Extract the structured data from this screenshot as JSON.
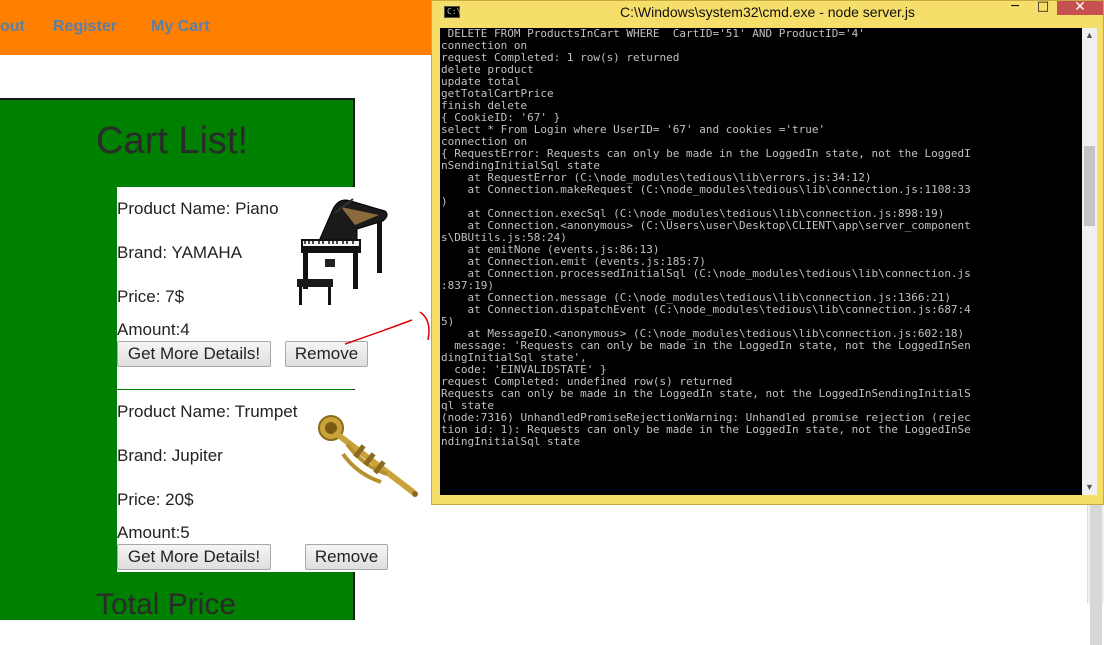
{
  "nav": {
    "items": [
      {
        "label": "out"
      },
      {
        "label": "Register"
      },
      {
        "label": "My Cart"
      }
    ]
  },
  "cart": {
    "title": "Cart List!",
    "total_label": "Total Price",
    "products": [
      {
        "name": "Product Name: Piano",
        "brand": "Brand: YAMAHA",
        "price": "Price: 7$",
        "amount": "Amount:4",
        "details_label": "Get More Details!",
        "remove_label": "Remove"
      },
      {
        "name": "Product Name: Trumpet",
        "brand": "Brand: Jupiter",
        "price": "Price: 20$",
        "amount": "Amount:5",
        "details_label": "Get More Details!",
        "remove_label": "Remove"
      }
    ]
  },
  "cmd": {
    "title": "C:\\Windows\\system32\\cmd.exe - node  server.js",
    "controls": {
      "minimize": "─",
      "maximize": "□",
      "close": "✕"
    },
    "icon_text": "C:\\",
    "output": " DELETE FROM ProductsInCart WHERE  CartID='51' AND ProductID='4'\nconnection on\nrequest Completed: 1 row(s) returned\ndelete product\nupdate total\ngetTotalCartPrice\nfinish delete\n{ CookieID: '67' }\nselect * From Login where UserID= '67' and cookies ='true'\nconnection on\n{ RequestError: Requests can only be made in the LoggedIn state, not the LoggedI\nnSendingInitialSql state\n    at RequestError (C:\\node_modules\\tedious\\lib\\errors.js:34:12)\n    at Connection.makeRequest (C:\\node_modules\\tedious\\lib\\connection.js:1108:33\n)\n    at Connection.execSql (C:\\node_modules\\tedious\\lib\\connection.js:898:19)\n    at Connection.<anonymous> (C:\\Users\\user\\Desktop\\CLIENT\\app\\server_component\ns\\DBUtils.js:58:24)\n    at emitNone (events.js:86:13)\n    at Connection.emit (events.js:185:7)\n    at Connection.processedInitialSql (C:\\node_modules\\tedious\\lib\\connection.js\n:837:19)\n    at Connection.message (C:\\node_modules\\tedious\\lib\\connection.js:1366:21)\n    at Connection.dispatchEvent (C:\\node_modules\\tedious\\lib\\connection.js:687:4\n5)\n    at MessageIO.<anonymous> (C:\\node_modules\\tedious\\lib\\connection.js:602:18)\n  message: 'Requests can only be made in the LoggedIn state, not the LoggedInSen\ndingInitialSql state',\n  code: 'EINVALIDSTATE' }\nrequest Completed: undefined row(s) returned\nRequests can only be made in the LoggedIn state, not the LoggedInSendingInitialS\nql state\n(node:7316) UnhandledPromiseRejectionWarning: Unhandled promise rejection (rejec\ntion id: 1): Requests can only be made in the LoggedIn state, not the LoggedInSe\nndingInitialSql state"
  },
  "colors": {
    "navbar": "#ff7f00",
    "nav_link": "#5a7fa8",
    "cart_panel": "#008000",
    "cmd_frame": "#f6de6b",
    "cmd_background": "#000000",
    "cmd_text": "#c0c0c0",
    "close_button": "#c75050",
    "annotation": "#e00000"
  },
  "icons": {
    "product_1": "grand-piano-icon",
    "product_2": "trumpet-icon",
    "window": "cmd-console-icon"
  }
}
